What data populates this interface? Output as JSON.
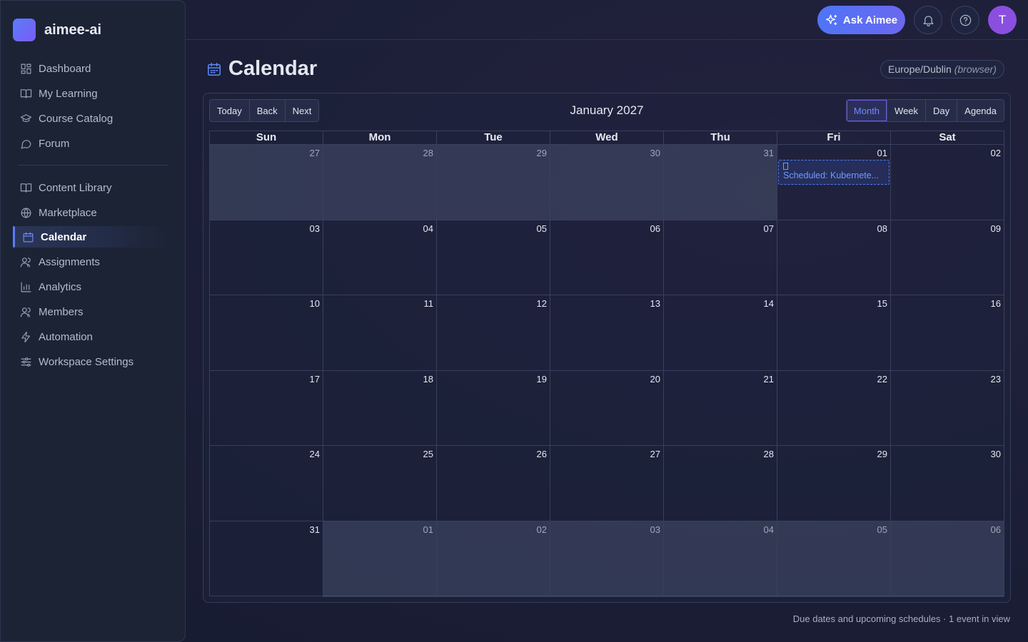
{
  "app": {
    "name": "aimee-ai"
  },
  "sidebar": {
    "primary": [
      {
        "label": "Dashboard",
        "icon": "dashboard-icon"
      },
      {
        "label": "My Learning",
        "icon": "book-open-icon"
      },
      {
        "label": "Course Catalog",
        "icon": "graduation-cap-icon"
      },
      {
        "label": "Forum",
        "icon": "chat-bubble-icon"
      }
    ],
    "secondary": [
      {
        "label": "Content Library",
        "icon": "book-open-icon"
      },
      {
        "label": "Marketplace",
        "icon": "globe-icon"
      },
      {
        "label": "Calendar",
        "icon": "calendar-icon",
        "active": true
      },
      {
        "label": "Assignments",
        "icon": "users-icon"
      },
      {
        "label": "Analytics",
        "icon": "bar-chart-icon"
      },
      {
        "label": "Members",
        "icon": "users-icon"
      },
      {
        "label": "Automation",
        "icon": "lightning-icon"
      },
      {
        "label": "Workspace Settings",
        "icon": "sliders-icon"
      }
    ]
  },
  "topbar": {
    "ask_label": "Ask Aimee",
    "avatar_initial": "T",
    "accent_color": "#5b7cfa",
    "avatar_color": "#8b4fe0"
  },
  "page": {
    "title": "Calendar",
    "timezone": "Europe/Dublin",
    "timezone_note": "(browser)"
  },
  "calendar": {
    "nav_buttons": [
      "Today",
      "Back",
      "Next"
    ],
    "label": "January 2027",
    "views": [
      "Month",
      "Week",
      "Day",
      "Agenda"
    ],
    "active_view": "Month",
    "weekdays": [
      "Sun",
      "Mon",
      "Tue",
      "Wed",
      "Thu",
      "Fri",
      "Sat"
    ],
    "weeks": [
      [
        {
          "d": "27",
          "off": true
        },
        {
          "d": "28",
          "off": true
        },
        {
          "d": "29",
          "off": true
        },
        {
          "d": "30",
          "off": true
        },
        {
          "d": "31",
          "off": true
        },
        {
          "d": "01",
          "off": false
        },
        {
          "d": "02",
          "off": false
        }
      ],
      [
        {
          "d": "03",
          "off": false
        },
        {
          "d": "04",
          "off": false
        },
        {
          "d": "05",
          "off": false
        },
        {
          "d": "06",
          "off": false
        },
        {
          "d": "07",
          "off": false
        },
        {
          "d": "08",
          "off": false
        },
        {
          "d": "09",
          "off": false
        }
      ],
      [
        {
          "d": "10",
          "off": false
        },
        {
          "d": "11",
          "off": false
        },
        {
          "d": "12",
          "off": false
        },
        {
          "d": "13",
          "off": false
        },
        {
          "d": "14",
          "off": false
        },
        {
          "d": "15",
          "off": false
        },
        {
          "d": "16",
          "off": false
        }
      ],
      [
        {
          "d": "17",
          "off": false
        },
        {
          "d": "18",
          "off": false
        },
        {
          "d": "19",
          "off": false
        },
        {
          "d": "20",
          "off": false
        },
        {
          "d": "21",
          "off": false
        },
        {
          "d": "22",
          "off": false
        },
        {
          "d": "23",
          "off": false
        }
      ],
      [
        {
          "d": "24",
          "off": false
        },
        {
          "d": "25",
          "off": false
        },
        {
          "d": "26",
          "off": false
        },
        {
          "d": "27",
          "off": false
        },
        {
          "d": "28",
          "off": false
        },
        {
          "d": "29",
          "off": false
        },
        {
          "d": "30",
          "off": false
        }
      ],
      [
        {
          "d": "31",
          "off": false
        },
        {
          "d": "01",
          "off": true
        },
        {
          "d": "02",
          "off": true
        },
        {
          "d": "03",
          "off": true
        },
        {
          "d": "04",
          "off": true
        },
        {
          "d": "05",
          "off": true
        },
        {
          "d": "06",
          "off": true
        }
      ]
    ],
    "events": [
      {
        "week": 0,
        "day": 5,
        "title": "Scheduled: Kubernete..."
      }
    ]
  },
  "footer": {
    "note": "Due dates and upcoming schedules · 1 event in view"
  }
}
